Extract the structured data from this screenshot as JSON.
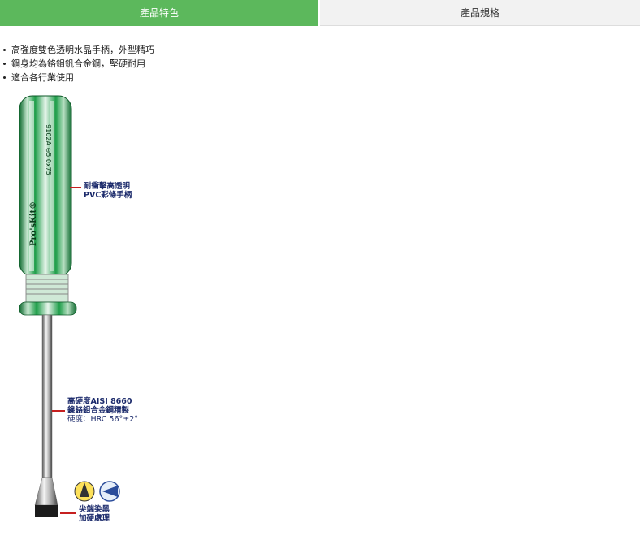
{
  "tabs": [
    {
      "label": "產品特色",
      "active": true
    },
    {
      "label": "產品規格",
      "active": false
    }
  ],
  "features": [
    "高強度雙色透明水晶手柄，外型精巧",
    "鋼身均為鉻鉬釩合金鋼，堅硬耐用",
    "適合各行業使用"
  ],
  "product": {
    "brand": "Pro'sKit®",
    "model_text": "9102A  ⊖5.0x75",
    "callouts": {
      "handle": [
        "耐衝擊高透明",
        "PVC彩條手柄"
      ],
      "shaft": [
        "高硬度AISI 8660",
        "鎳鉻鉬合金鋼精製",
        "硬度：HRC 56°±2°"
      ],
      "tip": [
        "尖端染黑",
        "加硬處理"
      ]
    },
    "badge_icons": [
      "hardness-badge-icon",
      "blade-tip-badge-icon"
    ]
  },
  "colors": {
    "active_tab": "#5cb85c",
    "inactive_tab": "#f2f2f2",
    "handle_green": "#1f9e4a",
    "callout_line": "#c62020",
    "callout_text": "#1b2a6b"
  }
}
